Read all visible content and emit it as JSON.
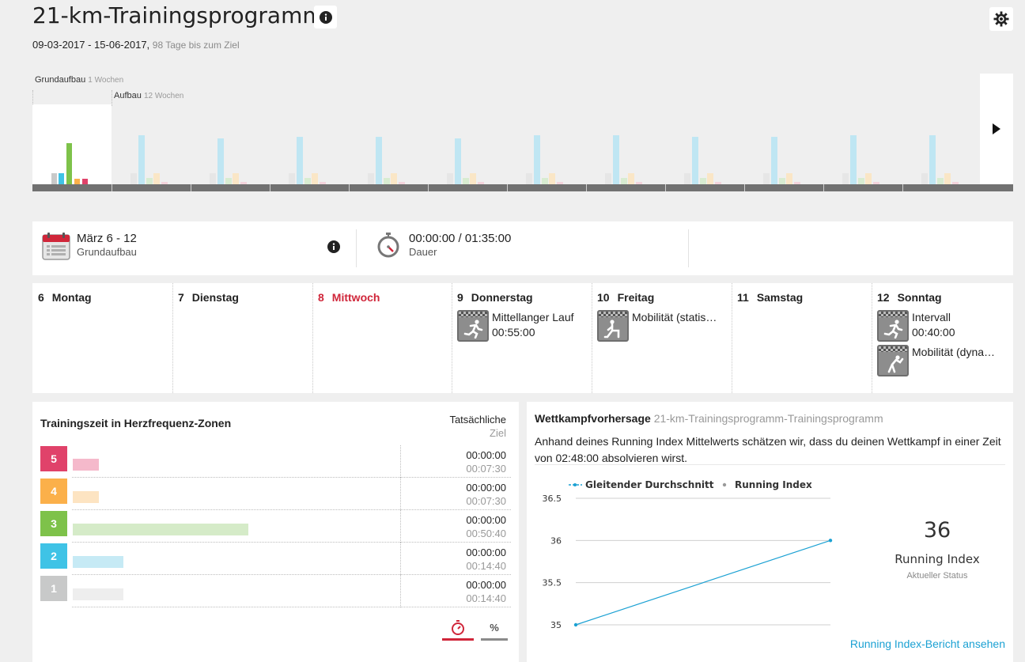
{
  "header": {
    "title": "21-km-Trainingsprogramm",
    "date_range": "09-03-2017 - 15-06-2017,",
    "days_to_goal": "98 Tage bis zum Ziel"
  },
  "phases": [
    {
      "name": "Grundaufbau",
      "duration": "1 Wochen"
    },
    {
      "name": "Aufbau",
      "duration": "12 Wochen"
    }
  ],
  "colors": {
    "zone5": "#e0426a",
    "zone4": "#fbb04a",
    "zone3": "#7ec24a",
    "zone2": "#3fc3e6",
    "zone1": "#c8c9c9",
    "accent_red": "#d0263a",
    "link_blue": "#1ba1d3"
  },
  "week": {
    "range": "März 6 - 12",
    "phase": "Grundaufbau",
    "duration_value": "00:00:00 / 01:35:00",
    "duration_label": "Dauer"
  },
  "days": [
    {
      "num": "6",
      "name": "Montag",
      "workouts": []
    },
    {
      "num": "7",
      "name": "Dienstag",
      "workouts": []
    },
    {
      "num": "8",
      "name": "Mittwoch",
      "today": true,
      "workouts": []
    },
    {
      "num": "9",
      "name": "Donnerstag",
      "workouts": [
        {
          "name": "Mittellanger Lauf",
          "time": "00:55:00",
          "icon": "running-icon"
        }
      ]
    },
    {
      "num": "10",
      "name": "Freitag",
      "workouts": [
        {
          "name": "Mobilität (statis…",
          "time": "",
          "icon": "mobility-static-icon"
        }
      ]
    },
    {
      "num": "11",
      "name": "Samstag",
      "workouts": []
    },
    {
      "num": "12",
      "name": "Sonntag",
      "workouts": [
        {
          "name": "Intervall",
          "time": "00:40:00",
          "icon": "running-icon"
        },
        {
          "name": "Mobilität (dyna…",
          "time": "",
          "icon": "mobility-dynamic-icon"
        }
      ]
    }
  ],
  "hr_zones": {
    "title": "Trainingszeit in Herzfrequenz-Zonen",
    "actual_label": "Tatsächliche",
    "goal_label": "Ziel",
    "zones": [
      {
        "zone": "5",
        "actual": "00:00:00",
        "goal": "00:07:30",
        "goal_fraction": 0.15
      },
      {
        "zone": "4",
        "actual": "00:00:00",
        "goal": "00:07:30",
        "goal_fraction": 0.15
      },
      {
        "zone": "3",
        "actual": "00:00:00",
        "goal": "00:50:40",
        "goal_fraction": 1.0
      },
      {
        "zone": "2",
        "actual": "00:00:00",
        "goal": "00:14:40",
        "goal_fraction": 0.29
      },
      {
        "zone": "1",
        "actual": "00:00:00",
        "goal": "00:14:40",
        "goal_fraction": 0.29
      }
    ],
    "pct_toggle": "%"
  },
  "race_prediction": {
    "title": "Wettkampfvorhersage",
    "program": "21-km-Trainingsprogramm-Trainingsprogramm",
    "description": "Anhand deines Running Index Mittelwerts schätzen wir, dass du deinen Wettkampf in einer Zeit von 02:48:00 absolvieren wirst.",
    "running_index_value": "36",
    "running_index_label": "Running Index",
    "running_index_status": "Aktueller Status",
    "report_link": "Running Index-Bericht ansehen"
  },
  "chart_data": {
    "type": "line",
    "legend": [
      "Gleitender Durchschnitt",
      "Running Index"
    ],
    "series": [
      {
        "name": "Gleitender Durchschnitt",
        "x": [
          0,
          1
        ],
        "values": [
          35.0,
          36.0
        ]
      }
    ],
    "y_ticks": [
      "36.5",
      "36",
      "35.5",
      "35"
    ],
    "ylim": [
      35,
      36.5
    ],
    "grid": true,
    "legend_position": "top"
  }
}
